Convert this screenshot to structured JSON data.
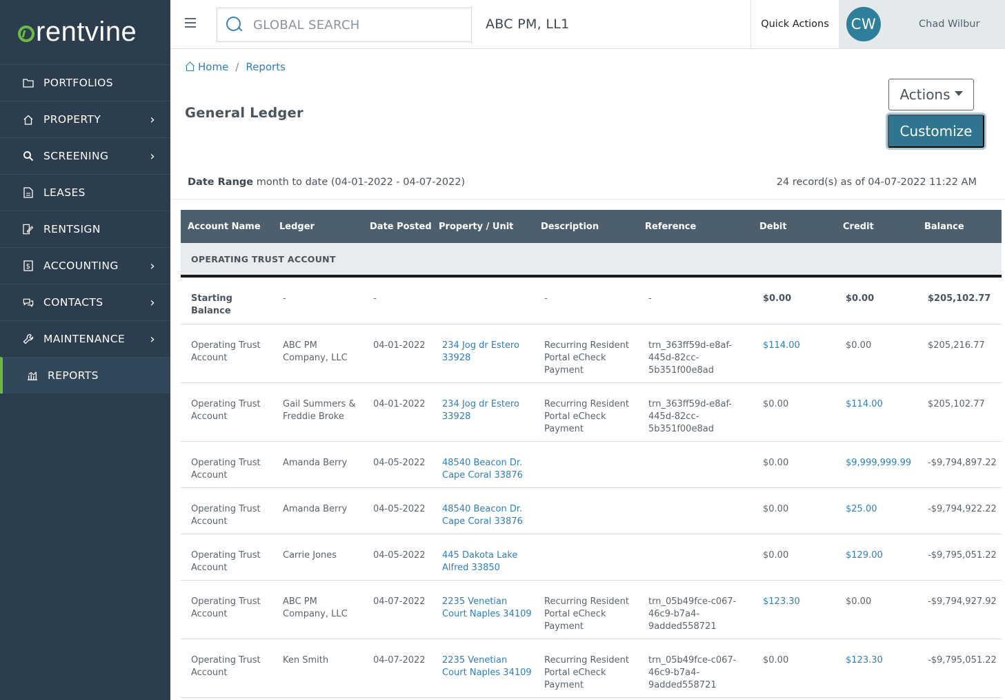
{
  "logo": {
    "text": "rentvine"
  },
  "sidebar": {
    "items": [
      {
        "label": "PORTFOLIOS",
        "icon": "folder-icon",
        "chevron": false
      },
      {
        "label": "PROPERTY",
        "icon": "home-icon",
        "chevron": true
      },
      {
        "label": "SCREENING",
        "icon": "magnify-icon",
        "chevron": true
      },
      {
        "label": "LEASES",
        "icon": "document-icon",
        "chevron": false
      },
      {
        "label": "RENTSIGN",
        "icon": "sign-icon",
        "chevron": false
      },
      {
        "label": "ACCOUNTING",
        "icon": "dollar-icon",
        "chevron": true
      },
      {
        "label": "CONTACTS",
        "icon": "chat-icon",
        "chevron": true
      },
      {
        "label": "MAINTENANCE",
        "icon": "wrench-icon",
        "chevron": true
      },
      {
        "label": "REPORTS",
        "icon": "chart-icon",
        "chevron": false,
        "active": true
      }
    ]
  },
  "topbar": {
    "search_placeholder": "GLOBAL SEARCH",
    "company": "ABC PM, LL1",
    "quick_actions": "Quick Actions",
    "avatar_initials": "CW",
    "user_name": "Chad Wilbur"
  },
  "breadcrumb": {
    "home": "Home",
    "separator": "/",
    "current": "Reports"
  },
  "page": {
    "title": "General Ledger",
    "actions_label": "Actions",
    "customize_label": "Customize",
    "date_range_label": "Date Range",
    "date_range_value": "month to date (04-01-2022 - 04-07-2022)",
    "records": "24 record(s) as of 04-07-2022 11:22 AM"
  },
  "table": {
    "headers": [
      "Account Name",
      "Ledger",
      "Date Posted",
      "Property / Unit",
      "Description",
      "Reference",
      "Debit",
      "Credit",
      "Balance"
    ],
    "group": "OPERATING TRUST ACCOUNT",
    "starting": {
      "account": "Starting Balance",
      "ledger": "-",
      "date": "-",
      "property": "",
      "description": "-",
      "reference": "-",
      "debit": "$0.00",
      "credit": "$0.00",
      "balance": "$205,102.77"
    },
    "rows": [
      {
        "account": "Operating Trust Account",
        "ledger": "ABC PM Company, LLC",
        "date": "04-01-2022",
        "property": "234 Jog dr Estero 33928",
        "description": "Recurring Resident Portal eCheck Payment",
        "reference": "trn_363ff59d-e8af-445d-82cc-5b351f00e8ad",
        "debit": "$114.00",
        "credit": "$0.00",
        "balance": "$205,216.77",
        "debit_link": true,
        "credit_link": false
      },
      {
        "account": "Operating Trust Account",
        "ledger": "Gail Summers & Freddie Broke",
        "date": "04-01-2022",
        "property": "234 Jog dr Estero 33928",
        "description": "Recurring Resident Portal eCheck Payment",
        "reference": "trn_363ff59d-e8af-445d-82cc-5b351f00e8ad",
        "debit": "$0.00",
        "credit": "$114.00",
        "balance": "$205,102.77",
        "debit_link": false,
        "credit_link": true
      },
      {
        "account": "Operating Trust Account",
        "ledger": "Amanda Berry",
        "date": "04-05-2022",
        "property": "48540 Beacon Dr. Cape Coral 33876",
        "description": "",
        "reference": "",
        "debit": "$0.00",
        "credit": "$9,999,999.99",
        "balance": "-$9,794,897.22",
        "debit_link": false,
        "credit_link": true
      },
      {
        "account": "Operating Trust Account",
        "ledger": "Amanda Berry",
        "date": "04-05-2022",
        "property": "48540 Beacon Dr. Cape Coral 33876",
        "description": "",
        "reference": "",
        "debit": "$0.00",
        "credit": "$25.00",
        "balance": "-$9,794,922.22",
        "debit_link": false,
        "credit_link": true
      },
      {
        "account": "Operating Trust Account",
        "ledger": "Carrie Jones",
        "date": "04-05-2022",
        "property": "445 Dakota Lake Alfred 33850",
        "description": "",
        "reference": "",
        "debit": "$0.00",
        "credit": "$129.00",
        "balance": "-$9,795,051.22",
        "debit_link": false,
        "credit_link": true
      },
      {
        "account": "Operating Trust Account",
        "ledger": "ABC PM Company, LLC",
        "date": "04-07-2022",
        "property": "2235 Venetian Court Naples 34109",
        "description": "Recurring Resident Portal eCheck Payment",
        "reference": "trn_05b49fce-c067-46c9-b7a4-9added558721",
        "debit": "$123.30",
        "credit": "$0.00",
        "balance": "-$9,794,927.92",
        "debit_link": true,
        "credit_link": false
      },
      {
        "account": "Operating Trust Account",
        "ledger": "Ken Smith",
        "date": "04-07-2022",
        "property": "2235 Venetian Court Naples 34109",
        "description": "Recurring Resident Portal eCheck Payment",
        "reference": "trn_05b49fce-c067-46c9-b7a4-9added558721",
        "debit": "$0.00",
        "credit": "$123.30",
        "balance": "-$9,795,051.22",
        "debit_link": false,
        "credit_link": true
      }
    ]
  },
  "colors": {
    "sidebar_bg": "#2c3e4e",
    "accent_green": "#6dbb45",
    "link_blue": "#2f7fb4",
    "customize_bg": "#2f7590",
    "table_header_bg": "#4d5e6d"
  }
}
